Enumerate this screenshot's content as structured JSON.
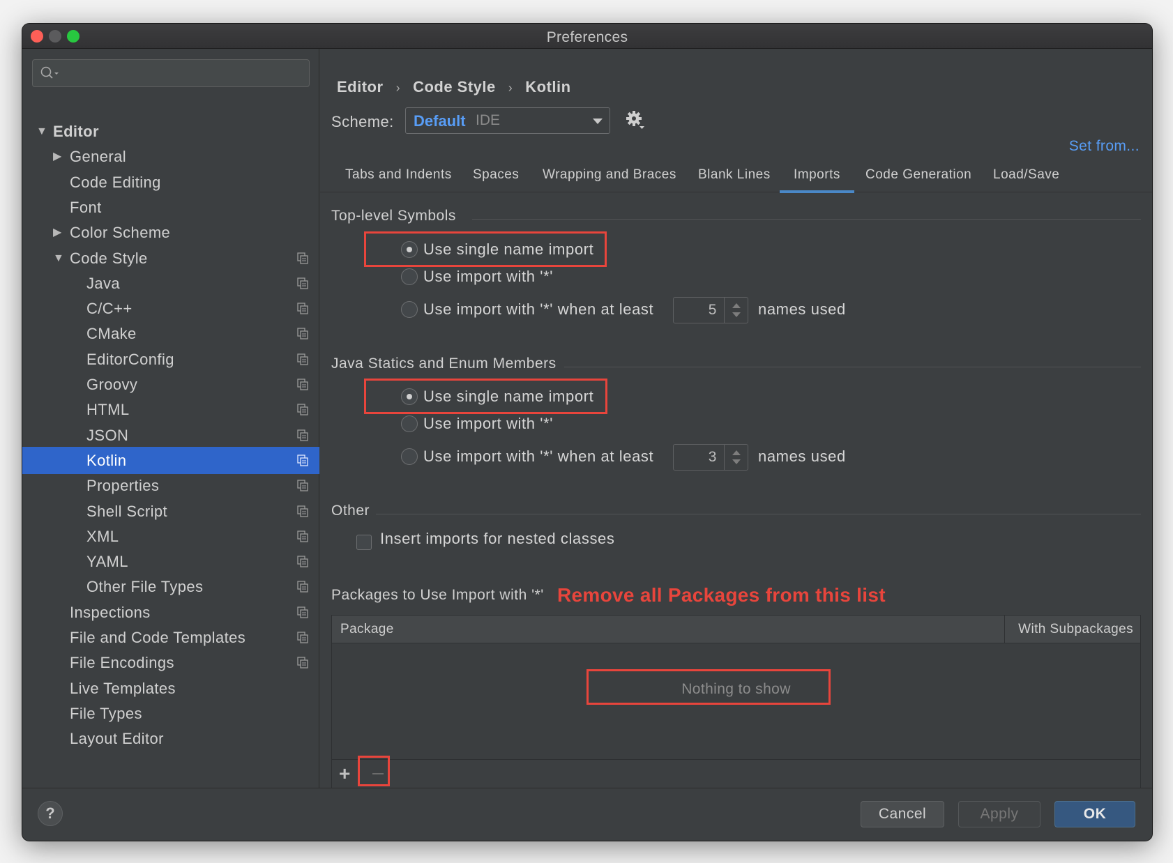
{
  "window": {
    "title": "Preferences"
  },
  "search": {
    "placeholder": ""
  },
  "sidebar": {
    "items": [
      {
        "label": "Editor",
        "arrow": "▼",
        "level": 0,
        "bold": true,
        "copy_icon": false
      },
      {
        "label": "General",
        "arrow": "▶",
        "level": 1,
        "copy_icon": false
      },
      {
        "label": "Code Editing",
        "arrow": "",
        "level": 1,
        "copy_icon": false
      },
      {
        "label": "Font",
        "arrow": "",
        "level": 1,
        "copy_icon": false
      },
      {
        "label": "Color Scheme",
        "arrow": "▶",
        "level": 1,
        "copy_icon": false
      },
      {
        "label": "Code Style",
        "arrow": "▼",
        "level": 1,
        "copy_icon": true
      },
      {
        "label": "Java",
        "arrow": "",
        "level": 2,
        "copy_icon": true
      },
      {
        "label": "C/C++",
        "arrow": "",
        "level": 2,
        "copy_icon": true
      },
      {
        "label": "CMake",
        "arrow": "",
        "level": 2,
        "copy_icon": true
      },
      {
        "label": "EditorConfig",
        "arrow": "",
        "level": 2,
        "copy_icon": true
      },
      {
        "label": "Groovy",
        "arrow": "",
        "level": 2,
        "copy_icon": true
      },
      {
        "label": "HTML",
        "arrow": "",
        "level": 2,
        "copy_icon": true
      },
      {
        "label": "JSON",
        "arrow": "",
        "level": 2,
        "copy_icon": true
      },
      {
        "label": "Kotlin",
        "arrow": "",
        "level": 2,
        "copy_icon": true,
        "selected": true
      },
      {
        "label": "Properties",
        "arrow": "",
        "level": 2,
        "copy_icon": true
      },
      {
        "label": "Shell Script",
        "arrow": "",
        "level": 2,
        "copy_icon": true
      },
      {
        "label": "XML",
        "arrow": "",
        "level": 2,
        "copy_icon": true
      },
      {
        "label": "YAML",
        "arrow": "",
        "level": 2,
        "copy_icon": true
      },
      {
        "label": "Other File Types",
        "arrow": "",
        "level": 2,
        "copy_icon": true
      },
      {
        "label": "Inspections",
        "arrow": "",
        "level": 1,
        "copy_icon": true
      },
      {
        "label": "File and Code Templates",
        "arrow": "",
        "level": 1,
        "copy_icon": true
      },
      {
        "label": "File Encodings",
        "arrow": "",
        "level": 1,
        "copy_icon": true
      },
      {
        "label": "Live Templates",
        "arrow": "",
        "level": 1,
        "copy_icon": false
      },
      {
        "label": "File Types",
        "arrow": "",
        "level": 1,
        "copy_icon": false
      },
      {
        "label": "Layout Editor",
        "arrow": "",
        "level": 1,
        "copy_icon": false
      }
    ]
  },
  "breadcrumb": {
    "items": [
      "Editor",
      "Code Style",
      "Kotlin"
    ],
    "separator": "›"
  },
  "scheme": {
    "label": "Scheme:",
    "name": "Default",
    "type": "IDE"
  },
  "set_from": "Set from...",
  "tabs": [
    {
      "label": "Tabs and Indents",
      "active": false
    },
    {
      "label": "Spaces",
      "active": false
    },
    {
      "label": "Wrapping and Braces",
      "active": false
    },
    {
      "label": "Blank Lines",
      "active": false
    },
    {
      "label": "Imports",
      "active": true
    },
    {
      "label": "Code Generation",
      "active": false
    },
    {
      "label": "Load/Save",
      "active": false
    }
  ],
  "top_level": {
    "title": "Top-level Symbols",
    "opt_single": "Use single name import",
    "opt_star": "Use import with '*'",
    "opt_star_when": "Use import with '*' when at least",
    "count": "5",
    "suffix": "names used",
    "selected": "single"
  },
  "java_statics": {
    "title": "Java Statics and Enum Members",
    "opt_single": "Use single name import",
    "opt_star": "Use import with '*'",
    "opt_star_when": "Use import with '*' when at least",
    "count": "3",
    "suffix": "names used",
    "selected": "single"
  },
  "other": {
    "title": "Other",
    "nested_label": "Insert imports for nested classes",
    "nested_checked": false
  },
  "packages": {
    "title": "Packages to Use Import with '*'",
    "annotation": "Remove all Packages from this list",
    "col_package": "Package",
    "col_subpackages": "With Subpackages",
    "empty_text": "Nothing to show",
    "add_symbol": "+"
  },
  "footer": {
    "help": "?",
    "cancel": "Cancel",
    "apply": "Apply",
    "ok": "OK"
  },
  "colors": {
    "background": "#3c3f41",
    "selection": "#2f65ca",
    "link": "#589df6",
    "annotation_red": "#e8453c",
    "ok_button": "#365880"
  }
}
